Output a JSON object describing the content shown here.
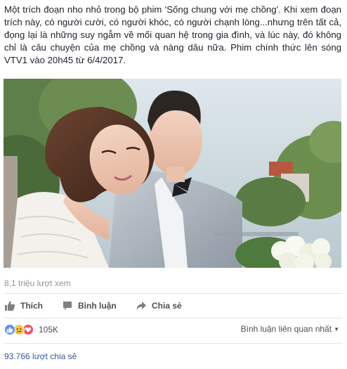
{
  "post": {
    "text": "Một trích đoạn nho nhỏ trong bộ phim 'Sống chung với mẹ chồng'. Khi xem đoạn trích này, có người cười, có người khóc, có người chạnh lòng...nhưng trên tất cả, đọng lại là những suy ngẫm về mối quan hệ trong gia đình, và lúc này, đó không chỉ là câu chuyện của mẹ chồng và nàng dâu nữa. Phim chính thức lên sóng VTV1 vào 20h45 từ 6/4/2017."
  },
  "video": {
    "views": "8,1 triệu lượt xem"
  },
  "actions": {
    "like": "Thích",
    "comment": "Bình luận",
    "share": "Chia sẻ",
    "like_icon": "thumbs-up-icon",
    "comment_icon": "comment-bubble-icon",
    "share_icon": "share-arrow-icon"
  },
  "reactions": {
    "types": [
      "like",
      "sad",
      "love"
    ],
    "count": "105K",
    "colors": {
      "like": "#5890ff",
      "sad": "#f7c648",
      "love": "#f25268"
    }
  },
  "comments": {
    "sort_label": "Bình luận liên quan nhất"
  },
  "shares": {
    "label": "93.766 lượt chia sẻ"
  }
}
